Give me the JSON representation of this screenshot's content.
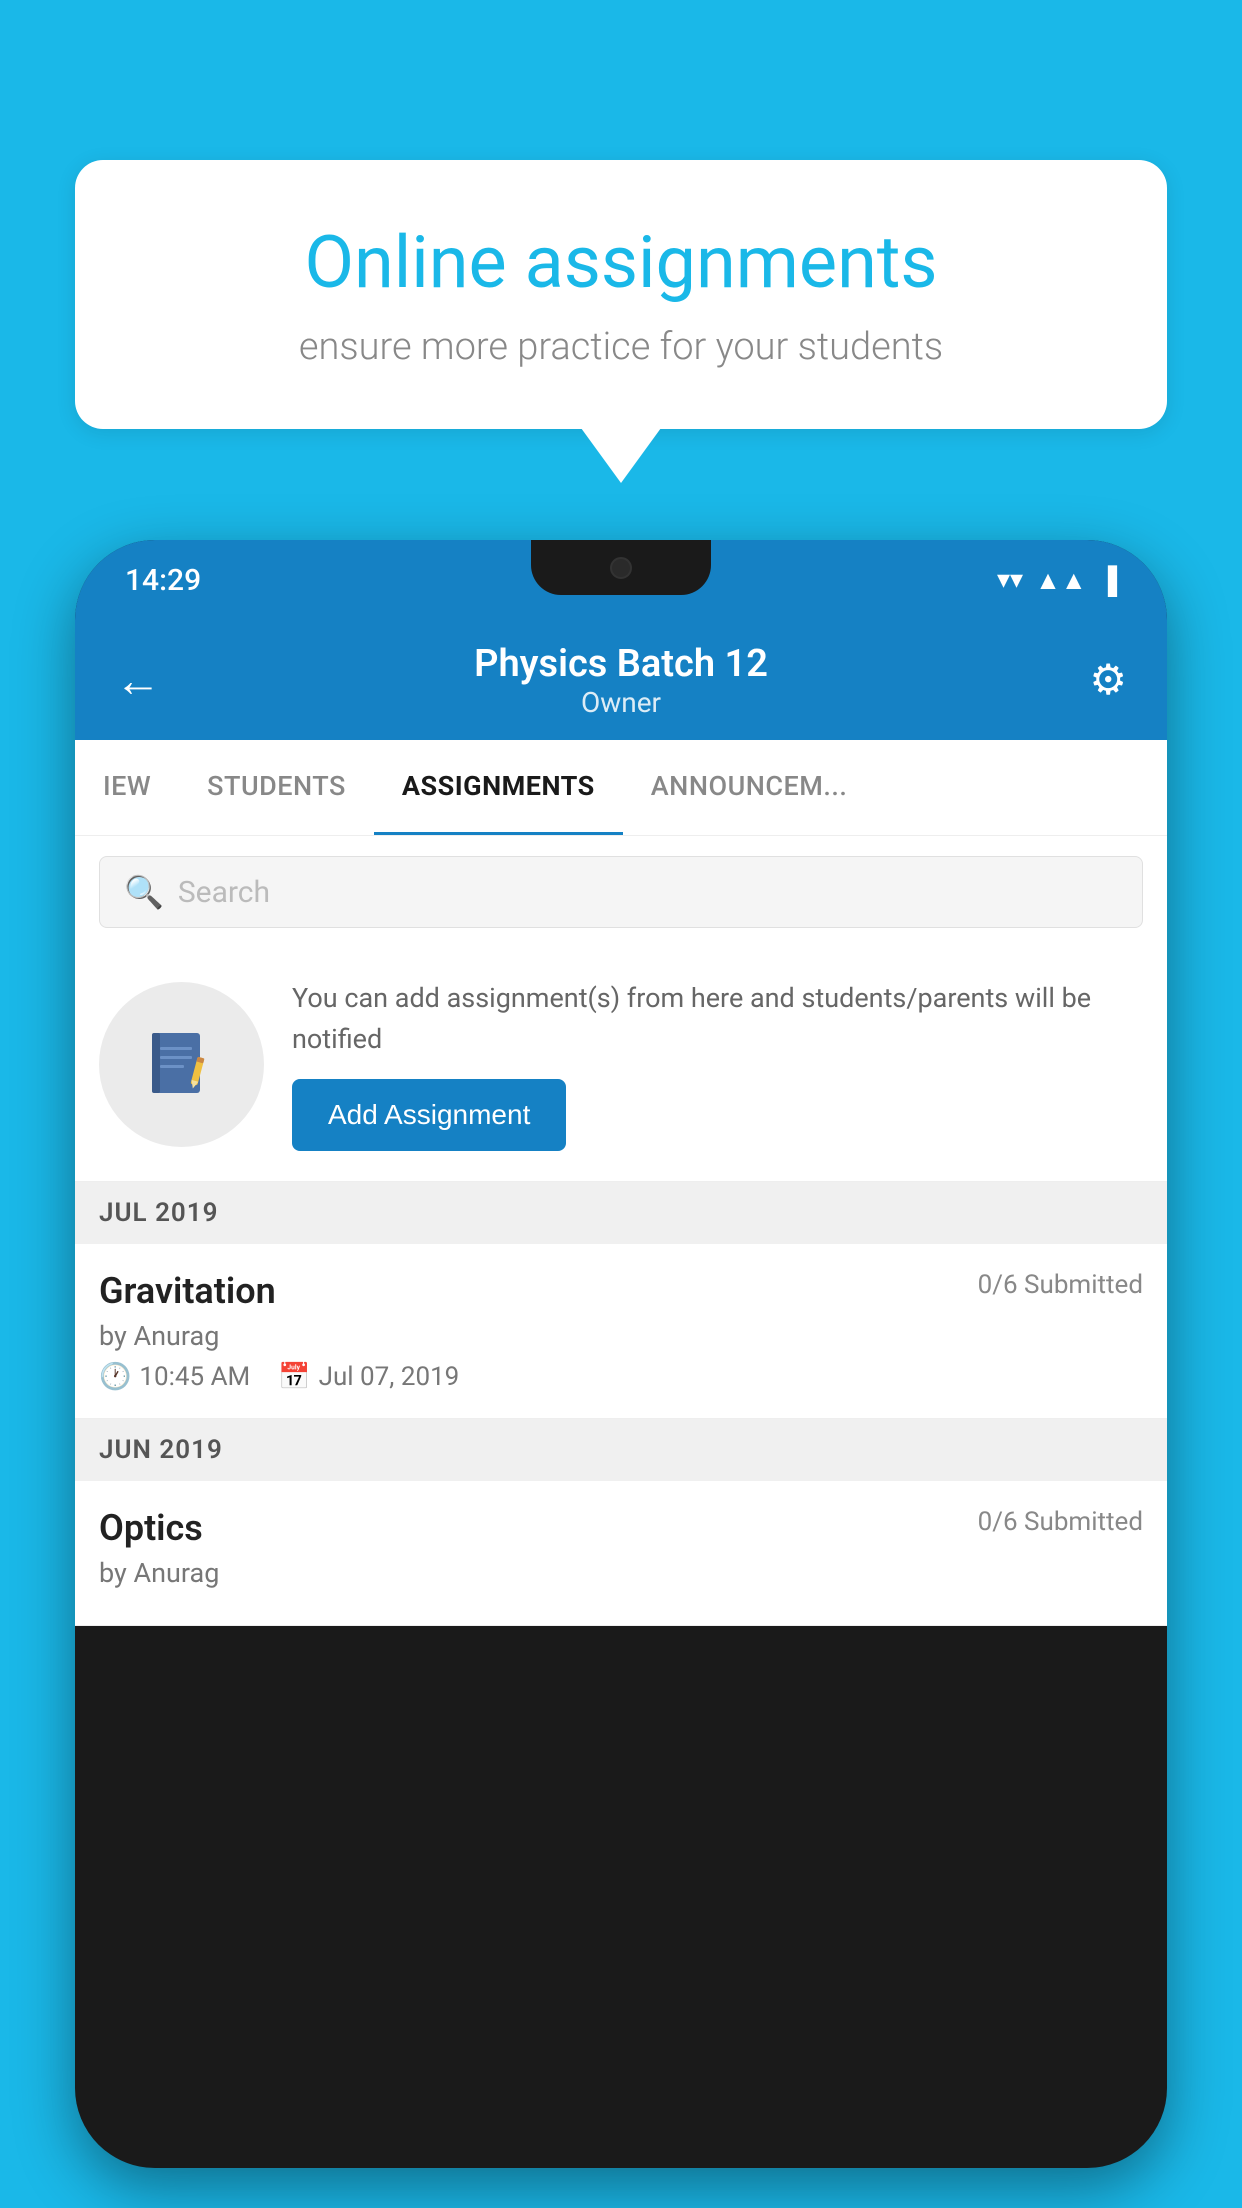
{
  "background_color": "#1ab8e8",
  "speech_bubble": {
    "title": "Online assignments",
    "subtitle": "ensure more practice for your students"
  },
  "status_bar": {
    "time": "14:29",
    "wifi_icon": "▲",
    "signal_icon": "▲",
    "battery_icon": "▌"
  },
  "header": {
    "title": "Physics Batch 12",
    "subtitle": "Owner",
    "back_icon": "←",
    "settings_icon": "⚙"
  },
  "tabs": [
    {
      "label": "IEW",
      "active": false
    },
    {
      "label": "STUDENTS",
      "active": false
    },
    {
      "label": "ASSIGNMENTS",
      "active": true
    },
    {
      "label": "ANNOUNCEM...",
      "active": false
    }
  ],
  "search": {
    "placeholder": "Search"
  },
  "promo": {
    "description": "You can add assignment(s) from here and students/parents will be notified",
    "button_label": "Add Assignment"
  },
  "sections": [
    {
      "month": "JUL 2019",
      "assignments": [
        {
          "name": "Gravitation",
          "submitted": "0/6 Submitted",
          "by": "by Anurag",
          "time": "10:45 AM",
          "date": "Jul 07, 2019"
        }
      ]
    },
    {
      "month": "JUN 2019",
      "assignments": [
        {
          "name": "Optics",
          "submitted": "0/6 Submitted",
          "by": "by Anurag",
          "time": "",
          "date": ""
        }
      ]
    }
  ]
}
